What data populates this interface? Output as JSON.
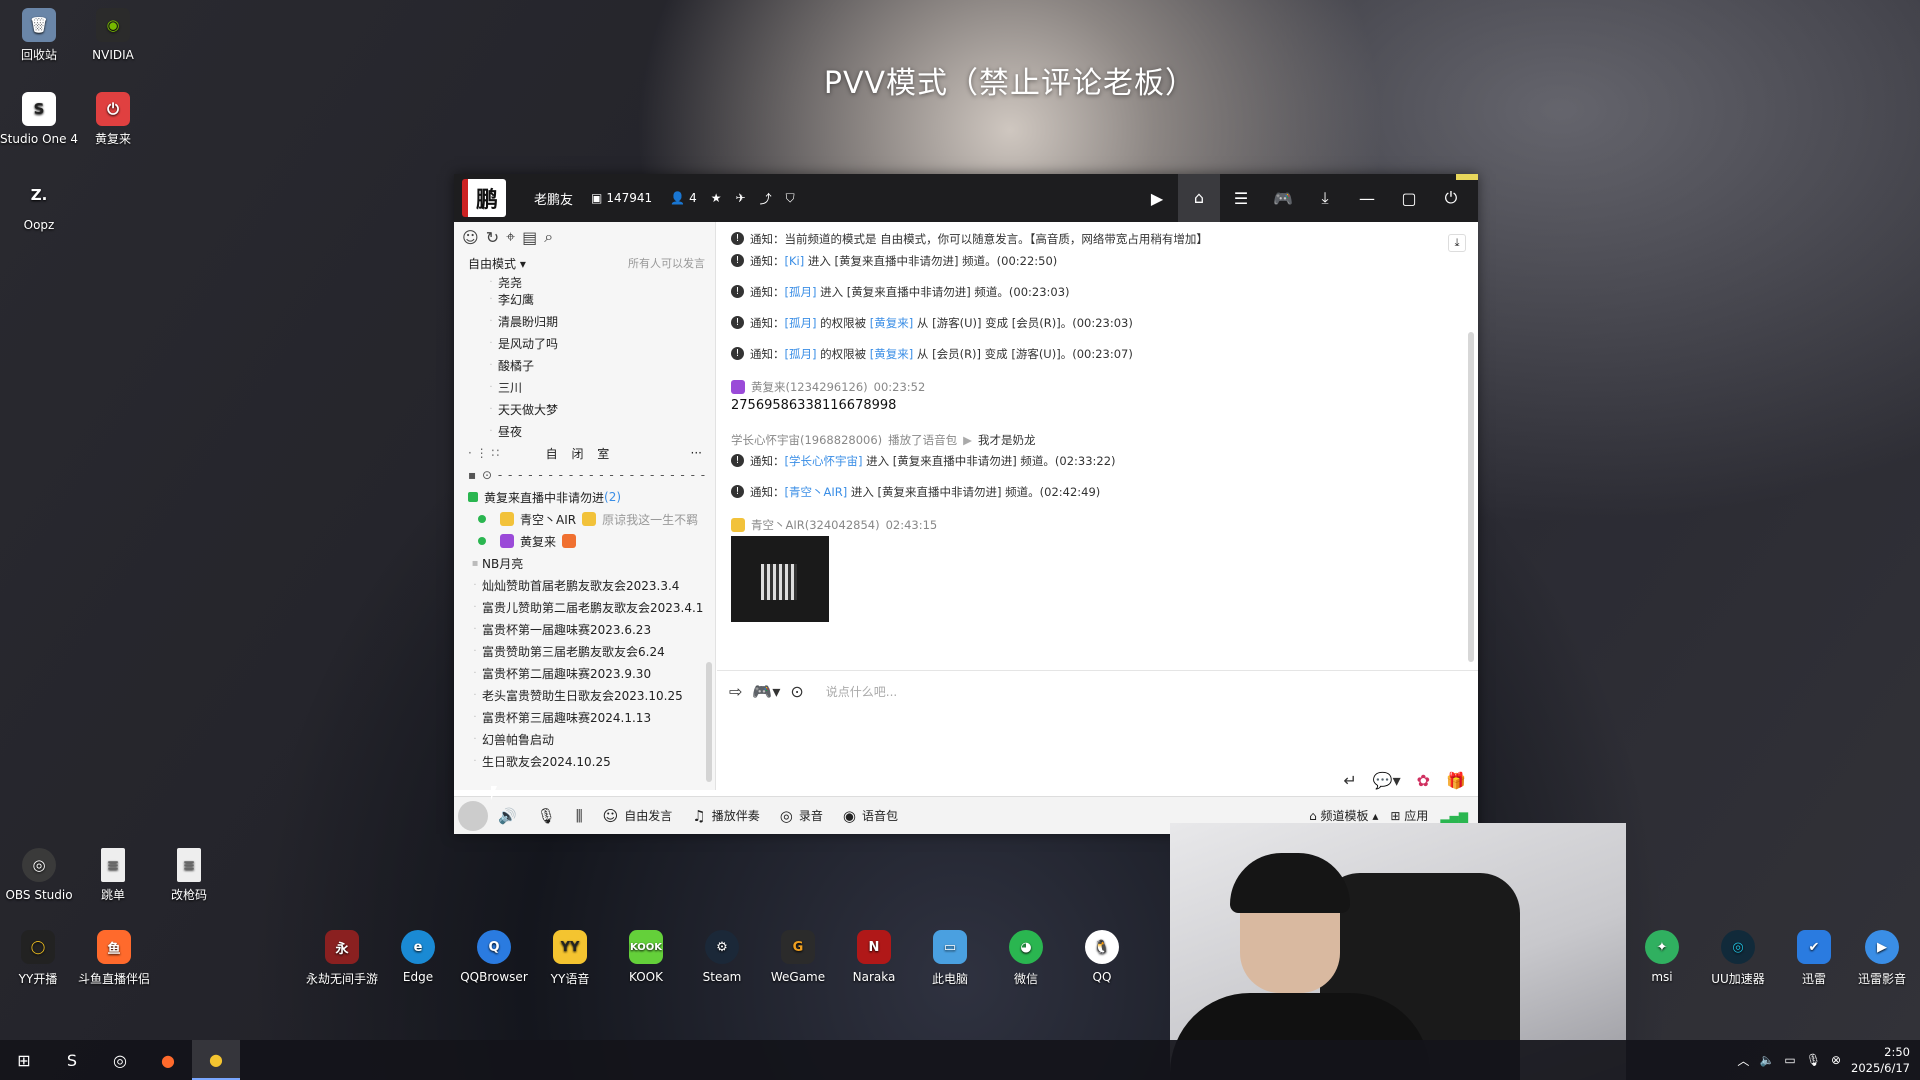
{
  "desktop_icons": [
    {
      "label": "回收站",
      "icon": "recycle-bin-icon",
      "color": "#6a86a8"
    },
    {
      "label": "NVIDIA",
      "icon": "nvidia-icon",
      "color": "#76b900"
    },
    {
      "label": "Studio One 4",
      "icon": "studio-one-icon",
      "color": "#333333"
    },
    {
      "label": "黄复来",
      "icon": "power-app-icon",
      "color": "#e04040"
    },
    {
      "label": "Oopz",
      "icon": "oopz-icon",
      "color": "#2b2b2b"
    },
    {
      "label": "OBS Studio",
      "icon": "obs-icon",
      "color": "#3a3a3a"
    },
    {
      "label": "跳单",
      "icon": "document-icon",
      "color": "#eeeeee"
    },
    {
      "label": "改枪码",
      "icon": "document-icon",
      "color": "#eeeeee"
    }
  ],
  "overlay_title": "PVV模式（禁止评论老板）",
  "window": {
    "logo_text": "鹏",
    "channel_name": "老鹏友",
    "channel_id": "147941",
    "online_count": "4"
  },
  "left_panel": {
    "mode_label": "自由模式",
    "mode_hint": "所有人可以发言",
    "members_top": [
      "尧尧",
      "李幻鹰",
      "清晨盼归期",
      "是风动了吗",
      "酸橘子",
      "三川",
      "天天做大梦",
      "昼夜"
    ],
    "room_name": "自 闭 室",
    "live_channel": {
      "name": "黄复来直播中非请勿进",
      "count": "(2)"
    },
    "live_members": [
      {
        "name": "青空丶AIR",
        "sign": "原谅我这一生不羁"
      },
      {
        "name": "黄复来",
        "sign": ""
      }
    ],
    "locked_channel": "NB月亮",
    "channels": [
      "灿灿赞助首届老鹏友歌友会2023.3.4",
      "富贵儿赞助第二届老鹏友歌友会2023.4.1",
      "富贵杯第一届趣味赛2023.6.23",
      "富贵赞助第三届老鹏友歌友会6.24",
      "富贵杯第二届趣味赛2023.9.30",
      "老头富贵赞助生日歌友会2023.10.25",
      "富贵杯第三届趣味赛2024.1.13",
      "幻兽帕鲁启动",
      "生日歌友会2024.10.25"
    ]
  },
  "chat": {
    "notices_top": [
      {
        "prefix": "通知：当前频道的模式是 自由模式，你可以随意发言。【高音质，网络带宽占用稍有增加】"
      },
      {
        "prefix": "通知：",
        "link": "[Ki]",
        "rest": " 进入 [黄复来直播中非请勿进] 频道。(00:22:50)"
      },
      {
        "prefix": "通知：",
        "link": "[孤月]",
        "rest": " 进入 [黄复来直播中非请勿进] 频道。(00:23:03)"
      },
      {
        "prefix": "通知：",
        "link": "[孤月]",
        "mid": " 的权限被 ",
        "link2": "[黄复来]",
        "rest": " 从 [游客(U)] 变成 [会员(R)]。(00:23:03)"
      },
      {
        "prefix": "通知：",
        "link": "[孤月]",
        "mid": " 的权限被 ",
        "link2": "[黄复来]",
        "rest": " 从 [会员(R)] 变成 [游客(U)]。(00:23:07)"
      }
    ],
    "msg1": {
      "sender": "黄复来(1234296126)",
      "time": "00:23:52",
      "body": "27569586338116678998"
    },
    "voice_msg": {
      "sender": "学长心怀宇宙(1968828006)",
      "action": "播放了语音包",
      "clip": "我才是奶龙"
    },
    "notices_bottom": [
      {
        "prefix": "通知：",
        "link": "[学长心怀宇宙]",
        "rest": " 进入 [黄复来直播中非请勿进] 频道。(02:33:22)"
      },
      {
        "prefix": "通知：",
        "link": "[青空丶AIR]",
        "rest": " 进入 [黄复来直播中非请勿进] 频道。(02:42:49)"
      }
    ],
    "msg2": {
      "sender": "青空丶AIR(324042854)",
      "time": "02:43:15"
    },
    "input_placeholder": "说点什么吧..."
  },
  "bottom_bar": {
    "free_speech": "自由发言",
    "play_music": "播放伴奏",
    "record": "录音",
    "voice_pack": "语音包",
    "channel_template": "频道模板",
    "apps": "应用"
  },
  "app_row": [
    {
      "label": "YY开播",
      "icon": "yy-live-icon",
      "color": "#f0c020"
    },
    {
      "label": "斗鱼直播伴侣",
      "icon": "douyu-icon",
      "color": "#ff6a2c"
    },
    {
      "label": "永劫无间手游",
      "icon": "naraka-mobile-icon",
      "color": "#8a2020"
    },
    {
      "label": "Edge",
      "icon": "edge-icon",
      "color": "#1a8ad4"
    },
    {
      "label": "QQBrowser",
      "icon": "qqbrowser-icon",
      "color": "#2a7be0"
    },
    {
      "label": "YY语音",
      "icon": "yy-voice-icon",
      "color": "#f4c430"
    },
    {
      "label": "KOOK",
      "icon": "kook-icon",
      "color": "#64d03a"
    },
    {
      "label": "Steam",
      "icon": "steam-icon",
      "color": "#1b2838"
    },
    {
      "label": "WeGame",
      "icon": "wegame-icon",
      "color": "#f0a020"
    },
    {
      "label": "Naraka",
      "icon": "naraka-icon",
      "color": "#b01818"
    },
    {
      "label": "此电脑",
      "icon": "this-pc-icon",
      "color": "#4aa0e0"
    },
    {
      "label": "微信",
      "icon": "wechat-icon",
      "color": "#2ab650"
    },
    {
      "label": "QQ",
      "icon": "qq-icon",
      "color": "#222222"
    },
    {
      "label": "msi",
      "icon": "msi-icon",
      "color": "#30b060"
    },
    {
      "label": "UU加速器",
      "icon": "uu-icon",
      "color": "#1fa0c0"
    },
    {
      "label": "迅雷",
      "icon": "xunlei-icon",
      "color": "#2a7be0"
    },
    {
      "label": "迅雷影音",
      "icon": "xunlei-video-icon",
      "color": "#3a8ee6"
    }
  ],
  "taskbar": {
    "time": "2:50",
    "date": "2025/6/17"
  }
}
